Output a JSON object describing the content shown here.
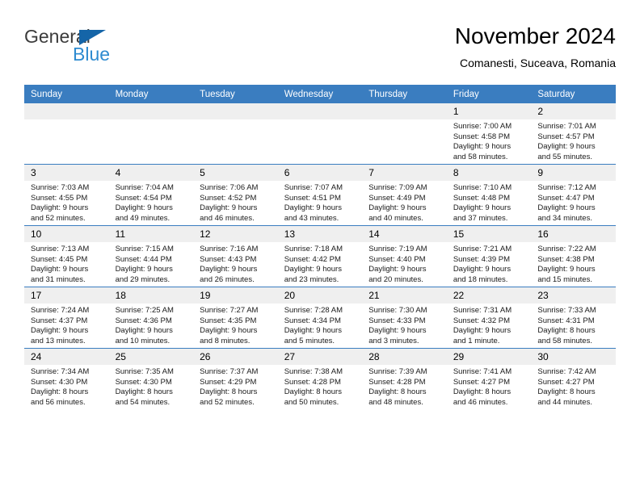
{
  "brand": {
    "name_part1": "General",
    "name_part2": "Blue"
  },
  "header": {
    "title": "November 2024",
    "subtitle": "Comanesti, Suceava, Romania"
  },
  "colors": {
    "header_blue": "#3a7dc0",
    "logo_blue": "#2e8bd0",
    "logo_triangle": "#1565a8",
    "daynum_bg": "#efefef"
  },
  "weekday_headers": [
    "Sunday",
    "Monday",
    "Tuesday",
    "Wednesday",
    "Thursday",
    "Friday",
    "Saturday"
  ],
  "weeks": [
    [
      {
        "day": "",
        "empty": true
      },
      {
        "day": "",
        "empty": true
      },
      {
        "day": "",
        "empty": true
      },
      {
        "day": "",
        "empty": true
      },
      {
        "day": "",
        "empty": true
      },
      {
        "day": "1",
        "sunrise": "Sunrise: 7:00 AM",
        "sunset": "Sunset: 4:58 PM",
        "daylight_1": "Daylight: 9 hours",
        "daylight_2": "and 58 minutes."
      },
      {
        "day": "2",
        "sunrise": "Sunrise: 7:01 AM",
        "sunset": "Sunset: 4:57 PM",
        "daylight_1": "Daylight: 9 hours",
        "daylight_2": "and 55 minutes."
      }
    ],
    [
      {
        "day": "3",
        "sunrise": "Sunrise: 7:03 AM",
        "sunset": "Sunset: 4:55 PM",
        "daylight_1": "Daylight: 9 hours",
        "daylight_2": "and 52 minutes."
      },
      {
        "day": "4",
        "sunrise": "Sunrise: 7:04 AM",
        "sunset": "Sunset: 4:54 PM",
        "daylight_1": "Daylight: 9 hours",
        "daylight_2": "and 49 minutes."
      },
      {
        "day": "5",
        "sunrise": "Sunrise: 7:06 AM",
        "sunset": "Sunset: 4:52 PM",
        "daylight_1": "Daylight: 9 hours",
        "daylight_2": "and 46 minutes."
      },
      {
        "day": "6",
        "sunrise": "Sunrise: 7:07 AM",
        "sunset": "Sunset: 4:51 PM",
        "daylight_1": "Daylight: 9 hours",
        "daylight_2": "and 43 minutes."
      },
      {
        "day": "7",
        "sunrise": "Sunrise: 7:09 AM",
        "sunset": "Sunset: 4:49 PM",
        "daylight_1": "Daylight: 9 hours",
        "daylight_2": "and 40 minutes."
      },
      {
        "day": "8",
        "sunrise": "Sunrise: 7:10 AM",
        "sunset": "Sunset: 4:48 PM",
        "daylight_1": "Daylight: 9 hours",
        "daylight_2": "and 37 minutes."
      },
      {
        "day": "9",
        "sunrise": "Sunrise: 7:12 AM",
        "sunset": "Sunset: 4:47 PM",
        "daylight_1": "Daylight: 9 hours",
        "daylight_2": "and 34 minutes."
      }
    ],
    [
      {
        "day": "10",
        "sunrise": "Sunrise: 7:13 AM",
        "sunset": "Sunset: 4:45 PM",
        "daylight_1": "Daylight: 9 hours",
        "daylight_2": "and 31 minutes."
      },
      {
        "day": "11",
        "sunrise": "Sunrise: 7:15 AM",
        "sunset": "Sunset: 4:44 PM",
        "daylight_1": "Daylight: 9 hours",
        "daylight_2": "and 29 minutes."
      },
      {
        "day": "12",
        "sunrise": "Sunrise: 7:16 AM",
        "sunset": "Sunset: 4:43 PM",
        "daylight_1": "Daylight: 9 hours",
        "daylight_2": "and 26 minutes."
      },
      {
        "day": "13",
        "sunrise": "Sunrise: 7:18 AM",
        "sunset": "Sunset: 4:42 PM",
        "daylight_1": "Daylight: 9 hours",
        "daylight_2": "and 23 minutes."
      },
      {
        "day": "14",
        "sunrise": "Sunrise: 7:19 AM",
        "sunset": "Sunset: 4:40 PM",
        "daylight_1": "Daylight: 9 hours",
        "daylight_2": "and 20 minutes."
      },
      {
        "day": "15",
        "sunrise": "Sunrise: 7:21 AM",
        "sunset": "Sunset: 4:39 PM",
        "daylight_1": "Daylight: 9 hours",
        "daylight_2": "and 18 minutes."
      },
      {
        "day": "16",
        "sunrise": "Sunrise: 7:22 AM",
        "sunset": "Sunset: 4:38 PM",
        "daylight_1": "Daylight: 9 hours",
        "daylight_2": "and 15 minutes."
      }
    ],
    [
      {
        "day": "17",
        "sunrise": "Sunrise: 7:24 AM",
        "sunset": "Sunset: 4:37 PM",
        "daylight_1": "Daylight: 9 hours",
        "daylight_2": "and 13 minutes."
      },
      {
        "day": "18",
        "sunrise": "Sunrise: 7:25 AM",
        "sunset": "Sunset: 4:36 PM",
        "daylight_1": "Daylight: 9 hours",
        "daylight_2": "and 10 minutes."
      },
      {
        "day": "19",
        "sunrise": "Sunrise: 7:27 AM",
        "sunset": "Sunset: 4:35 PM",
        "daylight_1": "Daylight: 9 hours",
        "daylight_2": "and 8 minutes."
      },
      {
        "day": "20",
        "sunrise": "Sunrise: 7:28 AM",
        "sunset": "Sunset: 4:34 PM",
        "daylight_1": "Daylight: 9 hours",
        "daylight_2": "and 5 minutes."
      },
      {
        "day": "21",
        "sunrise": "Sunrise: 7:30 AM",
        "sunset": "Sunset: 4:33 PM",
        "daylight_1": "Daylight: 9 hours",
        "daylight_2": "and 3 minutes."
      },
      {
        "day": "22",
        "sunrise": "Sunrise: 7:31 AM",
        "sunset": "Sunset: 4:32 PM",
        "daylight_1": "Daylight: 9 hours",
        "daylight_2": "and 1 minute."
      },
      {
        "day": "23",
        "sunrise": "Sunrise: 7:33 AM",
        "sunset": "Sunset: 4:31 PM",
        "daylight_1": "Daylight: 8 hours",
        "daylight_2": "and 58 minutes."
      }
    ],
    [
      {
        "day": "24",
        "sunrise": "Sunrise: 7:34 AM",
        "sunset": "Sunset: 4:30 PM",
        "daylight_1": "Daylight: 8 hours",
        "daylight_2": "and 56 minutes."
      },
      {
        "day": "25",
        "sunrise": "Sunrise: 7:35 AM",
        "sunset": "Sunset: 4:30 PM",
        "daylight_1": "Daylight: 8 hours",
        "daylight_2": "and 54 minutes."
      },
      {
        "day": "26",
        "sunrise": "Sunrise: 7:37 AM",
        "sunset": "Sunset: 4:29 PM",
        "daylight_1": "Daylight: 8 hours",
        "daylight_2": "and 52 minutes."
      },
      {
        "day": "27",
        "sunrise": "Sunrise: 7:38 AM",
        "sunset": "Sunset: 4:28 PM",
        "daylight_1": "Daylight: 8 hours",
        "daylight_2": "and 50 minutes."
      },
      {
        "day": "28",
        "sunrise": "Sunrise: 7:39 AM",
        "sunset": "Sunset: 4:28 PM",
        "daylight_1": "Daylight: 8 hours",
        "daylight_2": "and 48 minutes."
      },
      {
        "day": "29",
        "sunrise": "Sunrise: 7:41 AM",
        "sunset": "Sunset: 4:27 PM",
        "daylight_1": "Daylight: 8 hours",
        "daylight_2": "and 46 minutes."
      },
      {
        "day": "30",
        "sunrise": "Sunrise: 7:42 AM",
        "sunset": "Sunset: 4:27 PM",
        "daylight_1": "Daylight: 8 hours",
        "daylight_2": "and 44 minutes."
      }
    ]
  ]
}
